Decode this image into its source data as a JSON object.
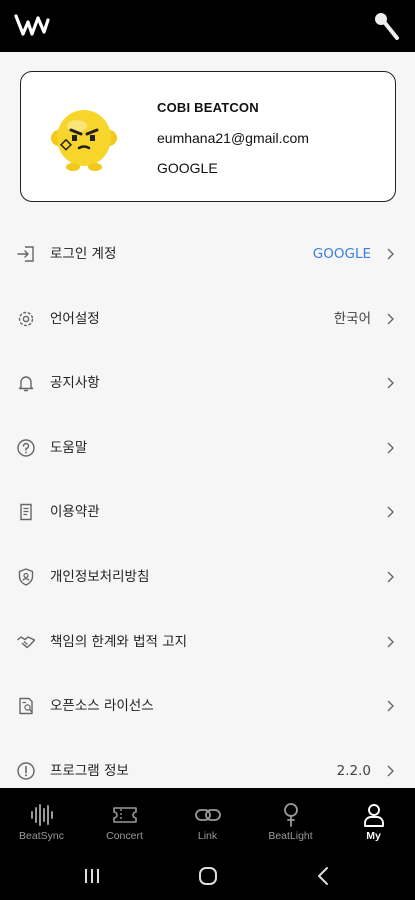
{
  "top_bar": {
    "logo_icon": "beatcon-logo-icon",
    "right_icon": "microphone-icon"
  },
  "profile": {
    "name": "COBI BEATCON",
    "email": "eumhana21@gmail.com",
    "provider": "GOOGLE",
    "avatar_icon": "yellow-character-avatar"
  },
  "menu": [
    {
      "label": "로그인 계정",
      "value": "GOOGLE",
      "icon": "login-icon"
    },
    {
      "label": "언어설정",
      "value": "한국어",
      "icon": "gear-icon"
    },
    {
      "label": "공지사항",
      "value": "",
      "icon": "bell-icon"
    },
    {
      "label": "도움말",
      "value": "",
      "icon": "help-icon"
    },
    {
      "label": "이용약관",
      "value": "",
      "icon": "document-icon"
    },
    {
      "label": "개인정보처리방침",
      "value": "",
      "icon": "shield-icon"
    },
    {
      "label": "책임의 한계와 법적 고지",
      "value": "",
      "icon": "handshake-icon"
    },
    {
      "label": "오픈소스 라이선스",
      "value": "",
      "icon": "license-icon"
    },
    {
      "label": "프로그램 정보",
      "value": "2.2.0",
      "icon": "info-icon"
    }
  ],
  "tabs": [
    {
      "label": "BeatSync",
      "icon": "waveform-icon",
      "active": false
    },
    {
      "label": "Concert",
      "icon": "ticket-icon",
      "active": false
    },
    {
      "label": "Link",
      "icon": "link-icon",
      "active": false
    },
    {
      "label": "BeatLight",
      "icon": "lightstick-icon",
      "active": false
    },
    {
      "label": "My",
      "icon": "person-icon",
      "active": true
    }
  ],
  "colors": {
    "accent": "#3b7de0",
    "bar_background": "#000000",
    "page_background": "#f6f6f6"
  }
}
